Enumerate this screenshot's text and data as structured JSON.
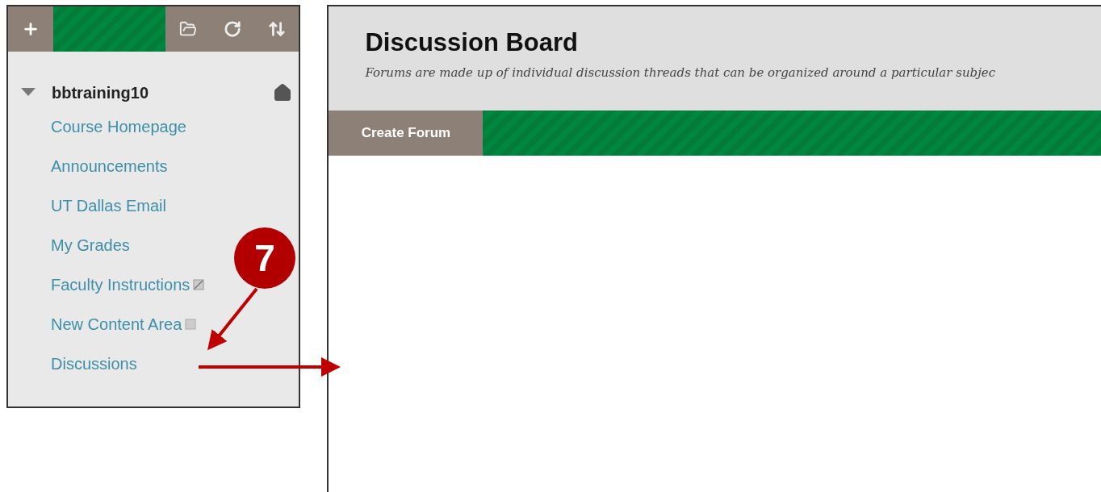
{
  "sidebar": {
    "course": {
      "title": "bbtraining10",
      "expanded": true
    },
    "items": [
      {
        "label": "Course Homepage",
        "kind": "plain"
      },
      {
        "label": "Announcements",
        "kind": "plain"
      },
      {
        "label": "UT Dallas Email",
        "kind": "plain"
      },
      {
        "label": "My Grades",
        "kind": "plain"
      },
      {
        "label": "Faculty Instructions",
        "kind": "hidden"
      },
      {
        "label": "New Content Area",
        "kind": "empty"
      },
      {
        "label": "Discussions",
        "kind": "plain"
      }
    ]
  },
  "page": {
    "title": "Discussion Board",
    "description": "Forums are made up of individual discussion threads that can be organized around a particular subjec",
    "buttons": [
      "Create Forum"
    ]
  },
  "callout": {
    "number": "7"
  }
}
